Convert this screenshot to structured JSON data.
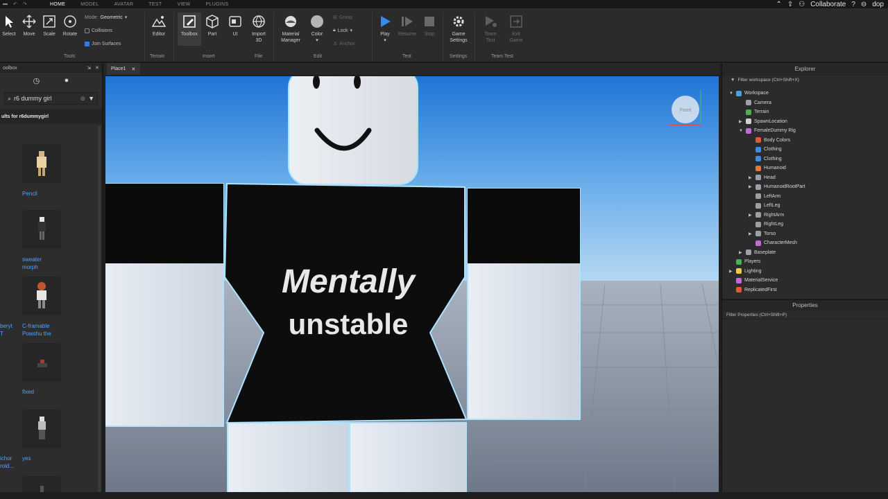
{
  "menubar": {
    "tabs": [
      "HOME",
      "MODEL",
      "AVATAR",
      "TEST",
      "VIEW",
      "PLUGINS"
    ],
    "active_tab": "HOME",
    "collaborate": "Collaborate",
    "user_initials": "dop"
  },
  "ribbon": {
    "tools": {
      "select": "Select",
      "move": "Move",
      "scale": "Scale",
      "rotate": "Rotate",
      "mode_label": "Mode:",
      "mode_value": "Geometric",
      "collisions": "Collisions",
      "join_surfaces": "Join Surfaces",
      "group": "Tools"
    },
    "terrain": {
      "editor": "Editor",
      "group": "Terrain"
    },
    "insert": {
      "toolbox": "Toolbox",
      "part": "Part",
      "ui": "UI",
      "group": "Insert"
    },
    "file": {
      "import3d_1": "Import",
      "import3d_2": "3D",
      "group": "File"
    },
    "edit": {
      "material_1": "Material",
      "material_2": "Manager",
      "color": "Color",
      "group_btn": "Group",
      "lock": "Lock",
      "anchor": "Anchor",
      "group": "Edit"
    },
    "test": {
      "play": "Play",
      "resume": "Resume",
      "stop": "Stop",
      "group": "Test"
    },
    "settings": {
      "game_1": "Game",
      "game_2": "Settings",
      "group": "Settings"
    },
    "team_test": {
      "team_1": "Team",
      "team_2": "Test",
      "exit_1": "Exit",
      "exit_2": "Game",
      "group": "Team Test"
    }
  },
  "toolbox": {
    "title": "oolbox",
    "search_value": "r6 dummy girl",
    "results_header": "ults for r6dummygirl",
    "items": [
      {
        "label": "Pencil"
      },
      {
        "label": "sweater",
        "label2": "morph"
      },
      {
        "label": "C-framable",
        "label2": "Powshu the"
      },
      {
        "label": "fixed"
      },
      {
        "label": "yes"
      }
    ],
    "left_labels": [
      {
        "l1": "beryt",
        "l2": "T"
      },
      {
        "l1": ""
      },
      {
        "l1": "ichor",
        "l2": "rold..."
      }
    ]
  },
  "viewport": {
    "tab": "Place1",
    "shirt_line1": "Mentally",
    "shirt_line2": "unstable",
    "view_cube": "Front"
  },
  "explorer": {
    "title": "Explorer",
    "filter": "Filter workspace (Ctrl+Shift+X)",
    "rows": [
      {
        "label": "Workspace",
        "indent": 0,
        "arrow": "▼",
        "color": "#4aa3e0"
      },
      {
        "label": "Camera",
        "indent": 1,
        "arrow": "",
        "color": "#9aa0a6"
      },
      {
        "label": "Terrain",
        "indent": 1,
        "arrow": "",
        "color": "#4caf50"
      },
      {
        "label": "SpawnLocation",
        "indent": 1,
        "arrow": "▶",
        "color": "#cfcfcf"
      },
      {
        "label": "FemaleDummy Rig",
        "indent": 1,
        "arrow": "▼",
        "color": "#c46ad4"
      },
      {
        "label": "Body Colors",
        "indent": 2,
        "arrow": "",
        "color": "#e0573a"
      },
      {
        "label": "Clothing",
        "indent": 2,
        "arrow": "",
        "color": "#3a8de0"
      },
      {
        "label": "Clothing",
        "indent": 2,
        "arrow": "",
        "color": "#3a8de0"
      },
      {
        "label": "Humanoid",
        "indent": 2,
        "arrow": "",
        "color": "#e07a3a"
      },
      {
        "label": "Head",
        "indent": 2,
        "arrow": "▶",
        "color": "#9aa0a6"
      },
      {
        "label": "HumanoidRootPart",
        "indent": 2,
        "arrow": "▶",
        "color": "#9aa0a6"
      },
      {
        "label": "LeftArm",
        "indent": 2,
        "arrow": "",
        "color": "#9aa0a6"
      },
      {
        "label": "LeftLeg",
        "indent": 2,
        "arrow": "",
        "color": "#9aa0a6"
      },
      {
        "label": "RightArm",
        "indent": 2,
        "arrow": "▶",
        "color": "#9aa0a6"
      },
      {
        "label": "RightLeg",
        "indent": 2,
        "arrow": "",
        "color": "#9aa0a6"
      },
      {
        "label": "Torso",
        "indent": 2,
        "arrow": "▶",
        "color": "#9aa0a6"
      },
      {
        "label": "CharacterMesh",
        "indent": 2,
        "arrow": "",
        "color": "#c46ad4"
      },
      {
        "label": "Baseplate",
        "indent": 1,
        "arrow": "▶",
        "color": "#9aa0a6"
      },
      {
        "label": "Players",
        "indent": 0,
        "arrow": "",
        "color": "#4caf50"
      },
      {
        "label": "Lighting",
        "indent": 0,
        "arrow": "▶",
        "color": "#f2c94c"
      },
      {
        "label": "MaterialService",
        "indent": 0,
        "arrow": "",
        "color": "#c46ad4"
      },
      {
        "label": "ReplicatedFirst",
        "indent": 0,
        "arrow": "",
        "color": "#e0573a"
      }
    ]
  },
  "properties": {
    "title": "Properties",
    "filter": "Filter Properties (Ctrl+Shift+P)"
  }
}
